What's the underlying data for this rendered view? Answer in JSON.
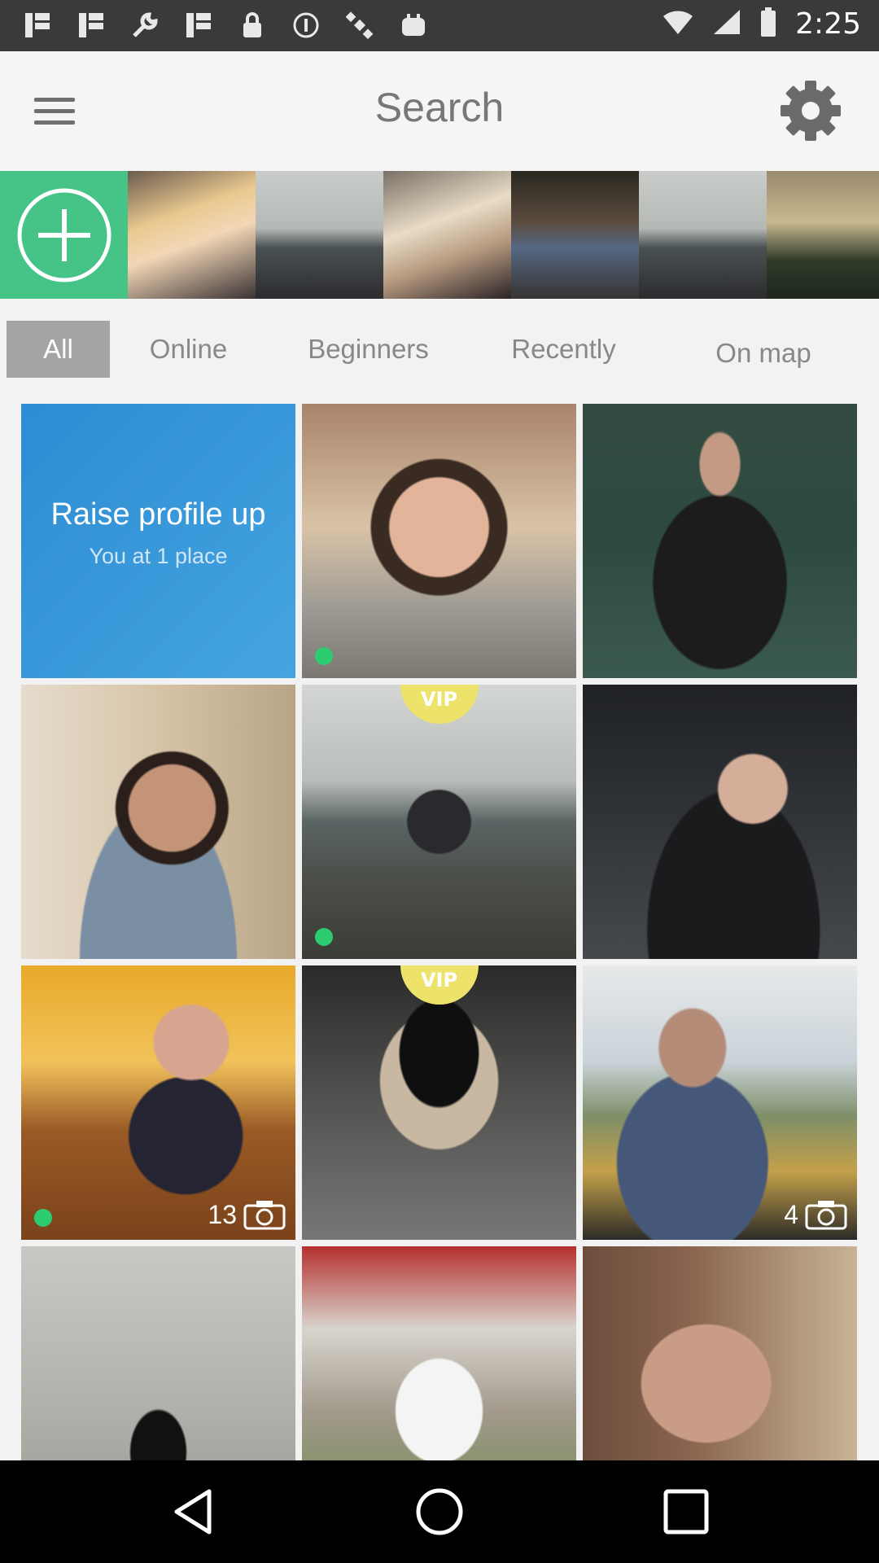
{
  "status_bar": {
    "time": "2:25",
    "icons": [
      "notification-icon",
      "notification-icon",
      "wrench-icon",
      "notification-icon",
      "lock-icon",
      "info-icon",
      "satellite-icon",
      "bag-icon"
    ]
  },
  "header": {
    "title": "Search",
    "menu_icon": "menu-icon",
    "settings_icon": "gear-icon"
  },
  "stories": {
    "add_icon": "add-icon",
    "count": 6
  },
  "filters": {
    "tabs": [
      {
        "label": "All",
        "active": true
      },
      {
        "label": "Online",
        "active": false
      },
      {
        "label": "Beginners",
        "active": false
      },
      {
        "label": "Recently",
        "active": false
      },
      {
        "label": "On map",
        "active": false
      }
    ]
  },
  "promo": {
    "title": "Raise profile up",
    "subtitle": "You at 1 place"
  },
  "grid": {
    "cards": [
      {
        "type": "promo"
      },
      {
        "type": "profile",
        "online": true
      },
      {
        "type": "profile",
        "online": false
      },
      {
        "type": "profile",
        "online": false
      },
      {
        "type": "profile",
        "online": true,
        "vip": "VIP"
      },
      {
        "type": "profile",
        "online": false
      },
      {
        "type": "profile",
        "online": true,
        "photos": "13"
      },
      {
        "type": "profile",
        "online": false,
        "vip": "VIP"
      },
      {
        "type": "profile",
        "online": false,
        "photos": "4"
      },
      {
        "type": "profile",
        "online": false
      },
      {
        "type": "profile",
        "online": false
      },
      {
        "type": "profile",
        "online": false
      }
    ]
  },
  "colors": {
    "accent": "#46c387",
    "promo": "#2d8cd2",
    "online": "#2ecc71",
    "vip": "#ede36a",
    "tab_active_bg": "#a4a4a4"
  },
  "nav": [
    "back-icon",
    "home-icon",
    "recents-icon"
  ]
}
